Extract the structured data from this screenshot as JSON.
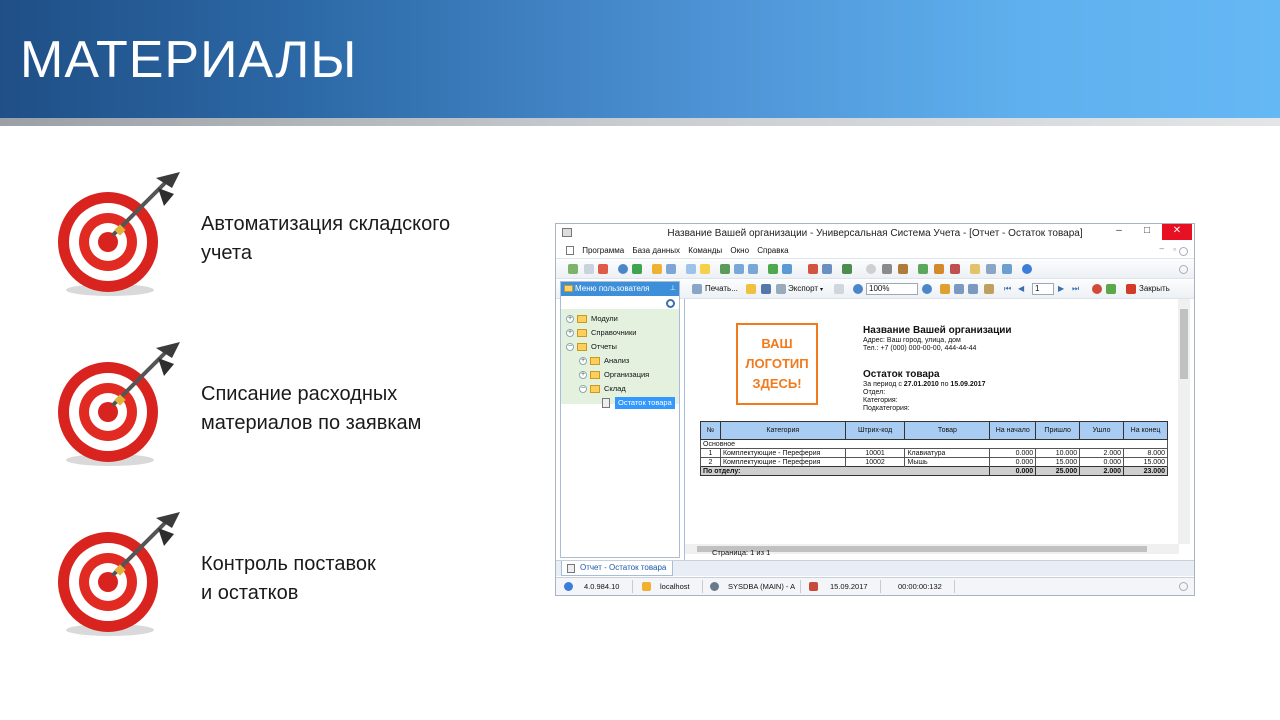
{
  "slide": {
    "title": "МАТЕРИАЛЫ",
    "bullets": [
      {
        "line1": "Автоматизация складского",
        "line2": "учета",
        "icon": "target-dart-icon"
      },
      {
        "line1": "Списание расходных",
        "line2": "материалов по заявкам",
        "icon": "target-dart-icon"
      },
      {
        "line1": "Контроль поставок",
        "line2": "и остатков",
        "icon": "target-dart-icon"
      }
    ],
    "colors": {
      "banner_dark": "#1f4f86",
      "banner_light": "#64b8f4",
      "target_red": "#e02020",
      "accent_orange": "#f07a1c"
    }
  },
  "window": {
    "title": "Название Вашей организации - Универсальная Система Учета - [Отчет - Остаток товара]",
    "controls": {
      "minimize": "–",
      "maximize": "□",
      "close": "✕"
    },
    "menu": [
      "Программа",
      "База данных",
      "Команды",
      "Окно",
      "Справка"
    ],
    "toolbar2": {
      "print_label": "Печать...",
      "export_label": "Экспорт",
      "zoom_value": "100%",
      "page_value": "1",
      "close_label": "Закрыть"
    },
    "left_panel": {
      "header": "Меню пользователя",
      "tree": [
        {
          "label": "Модули",
          "expander": "+"
        },
        {
          "label": "Справочники",
          "expander": "+"
        },
        {
          "label": "Отчеты",
          "expander": "−"
        },
        {
          "label": "Анализ",
          "expander": "+"
        },
        {
          "label": "Организация",
          "expander": "+"
        },
        {
          "label": "Склад",
          "expander": "−"
        },
        {
          "label": "Остаток товара",
          "expander": ""
        }
      ]
    },
    "report": {
      "logo_lines": [
        "ВАШ",
        "ЛОГОТИП",
        "ЗДЕСЬ!"
      ],
      "org_name": "Название Вашей организации",
      "address": "Адрес: Ваш город, улица, дом",
      "phone": "Тел.: +7 (000) 000-00-00, 444-44-44",
      "report_title": "Остаток товара",
      "period_prefix": "За период с",
      "period_from": "27.01.2010",
      "period_mid": "по",
      "period_to": "15.09.2017",
      "dept": "Отдел:",
      "category": "Категория:",
      "subcategory": "Подкатегория:",
      "columns": [
        "№",
        "Категория",
        "Штрих-код",
        "Товар",
        "На начало",
        "Пришло",
        "Ушло",
        "На конец"
      ],
      "group": "Основное",
      "rows": [
        [
          "1",
          "Комплектующие - Переферия",
          "10001",
          "Клавиатура",
          "0.000",
          "10.000",
          "2.000",
          "8.000"
        ],
        [
          "2",
          "Комплектующие - Переферия",
          "10002",
          "Мышь",
          "0.000",
          "15.000",
          "0.000",
          "15.000"
        ]
      ],
      "totals": {
        "label": "По отделу:",
        "start": "0.000",
        "in": "25.000",
        "out": "2.000",
        "end": "23.000"
      }
    },
    "page_status": "Страница: 1 из 1",
    "tab_label": "Отчет - Остаток товара",
    "statusbar": {
      "version": "4.0.984.10",
      "server": "localhost",
      "user": "SYSDBA (MAIN) - A",
      "date": "15.09.2017",
      "timer": "00:00:00:132"
    }
  }
}
